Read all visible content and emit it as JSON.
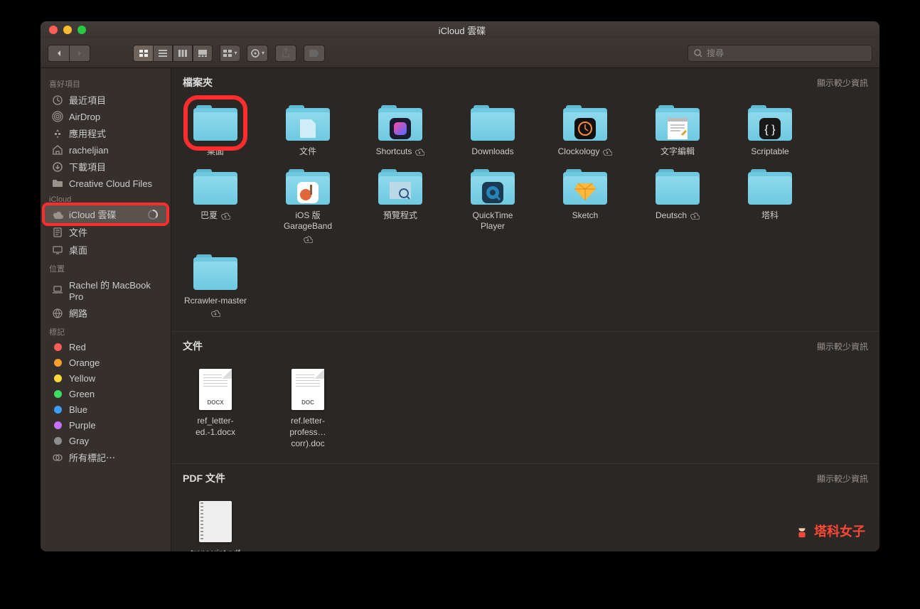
{
  "window": {
    "title": "iCloud 雲碟"
  },
  "toolbar": {
    "search_placeholder": "搜尋"
  },
  "sidebar": {
    "favorites_header": "喜好項目",
    "favorites": [
      {
        "label": "最近項目",
        "icon": "clock"
      },
      {
        "label": "AirDrop",
        "icon": "airdrop"
      },
      {
        "label": "應用程式",
        "icon": "apps"
      },
      {
        "label": "racheljian",
        "icon": "home"
      },
      {
        "label": "下載項目",
        "icon": "download"
      },
      {
        "label": "Creative Cloud Files",
        "icon": "folder"
      }
    ],
    "icloud_header": "iCloud",
    "icloud": [
      {
        "label": "iCloud 雲碟",
        "icon": "cloud",
        "selected": true,
        "progress": true
      },
      {
        "label": "文件",
        "icon": "doc"
      },
      {
        "label": "桌面",
        "icon": "desktop"
      }
    ],
    "locations_header": "位置",
    "locations": [
      {
        "label": "Rachel 的 MacBook Pro",
        "icon": "laptop"
      },
      {
        "label": "網路",
        "icon": "globe"
      }
    ],
    "tags_header": "標記",
    "tags": [
      {
        "label": "Red",
        "color": "#ff5b5b"
      },
      {
        "label": "Orange",
        "color": "#ff9f2e"
      },
      {
        "label": "Yellow",
        "color": "#ffd93a"
      },
      {
        "label": "Green",
        "color": "#3ddc62"
      },
      {
        "label": "Blue",
        "color": "#3b9dff"
      },
      {
        "label": "Purple",
        "color": "#c671ff"
      },
      {
        "label": "Gray",
        "color": "#8e8e8e"
      }
    ],
    "all_tags": "所有標記⋯"
  },
  "sections": {
    "folders": {
      "title": "檔案夾",
      "show_less": "顯示較少資訊",
      "items": [
        {
          "name": "桌面",
          "kind": "folder",
          "highlight": true
        },
        {
          "name": "文件",
          "kind": "folder",
          "inner": "blankdoc"
        },
        {
          "name": "Shortcuts",
          "kind": "folder",
          "inner": "shortcuts",
          "cloud": true
        },
        {
          "name": "Downloads",
          "kind": "folder"
        },
        {
          "name": "Clockology",
          "kind": "folder",
          "inner": "watch",
          "cloud": true
        },
        {
          "name": "文字編輯",
          "kind": "folder",
          "inner": "textedit"
        },
        {
          "name": "Scriptable",
          "kind": "folder",
          "inner": "braces"
        },
        {
          "name": "巴夏",
          "kind": "folder",
          "cloud": true
        },
        {
          "name": "iOS 版 GarageBand",
          "kind": "folder",
          "inner": "guitar",
          "cloud": true
        },
        {
          "name": "預覽程式",
          "kind": "folder",
          "inner": "preview"
        },
        {
          "name": "QuickTime Player",
          "kind": "folder",
          "inner": "quicktime"
        },
        {
          "name": "Sketch",
          "kind": "folder",
          "inner": "diamond"
        },
        {
          "name": "Deutsch",
          "kind": "folder",
          "cloud": true
        },
        {
          "name": "塔科",
          "kind": "folder"
        },
        {
          "name": "Rcrawler-master",
          "kind": "folder",
          "cloud": true
        }
      ]
    },
    "documents": {
      "title": "文件",
      "show_less": "顯示較少資訊",
      "items": [
        {
          "name": "ref_letter-ed.-1.docx",
          "kind": "docx"
        },
        {
          "name": "ref.letter-profess…corr).doc",
          "kind": "doc"
        }
      ]
    },
    "pdfs": {
      "title": "PDF 文件",
      "show_less": "顯示較少資訊",
      "items": [
        {
          "name": "transcript.pdf",
          "kind": "pdf"
        }
      ]
    }
  },
  "watermark": "塔科女子"
}
